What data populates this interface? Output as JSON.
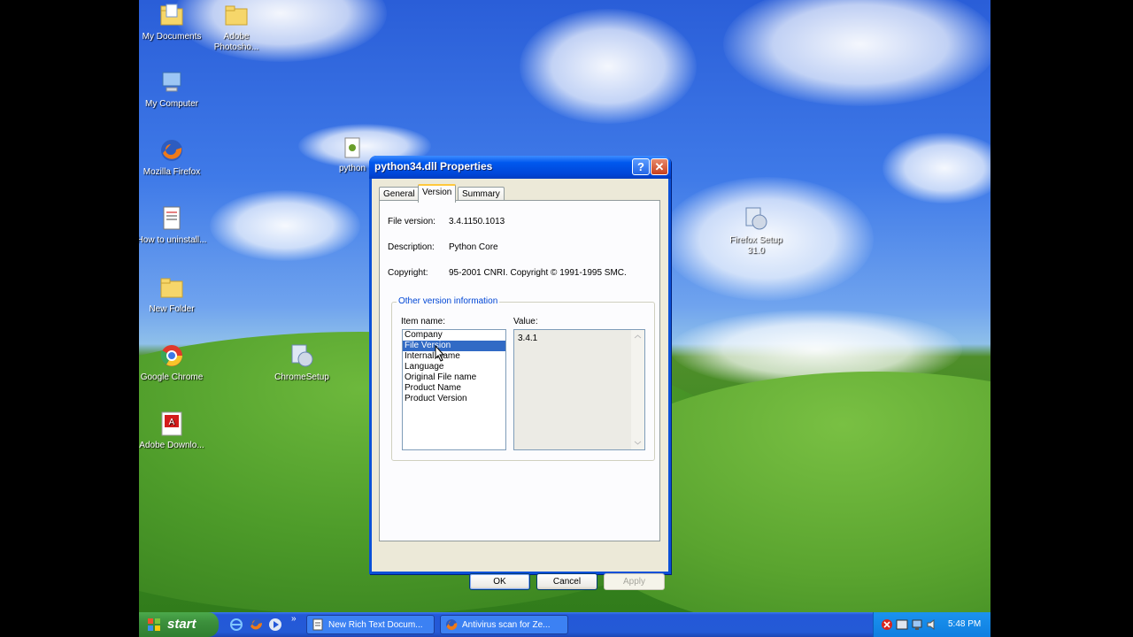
{
  "desktop": {
    "icons": [
      {
        "label": "My Documents"
      },
      {
        "label": "Adobe Photosho..."
      },
      {
        "label": "My Computer"
      },
      {
        "label": "Mozilla Firefox"
      },
      {
        "label": "How to uninstall..."
      },
      {
        "label": "New Folder"
      },
      {
        "label": "Google Chrome"
      },
      {
        "label": "ChromeSetup"
      },
      {
        "label": "Adobe Downlo..."
      },
      {
        "label": "Firefox Setup 31.0"
      },
      {
        "label": "python"
      }
    ]
  },
  "dialog": {
    "title": "python34.dll Properties",
    "help_label": "?",
    "close_label": "✕",
    "tabs": [
      {
        "label": "General"
      },
      {
        "label": "Version"
      },
      {
        "label": "Summary"
      }
    ],
    "file_version_label": "File version:",
    "file_version_value": "3.4.1150.1013",
    "description_label": "Description:",
    "description_value": "Python Core",
    "copyright_label": "Copyright:",
    "copyright_value": "95-2001 CNRI. Copyright © 1991-1995 SMC.",
    "group_title": "Other version information",
    "item_name_label": "Item name:",
    "value_label": "Value:",
    "items": [
      {
        "label": "Company"
      },
      {
        "label": "File Version"
      },
      {
        "label": "Internal Name"
      },
      {
        "label": "Language"
      },
      {
        "label": "Original File name"
      },
      {
        "label": "Product Name"
      },
      {
        "label": "Product Version"
      }
    ],
    "selected_value": "3.4.1",
    "ok_label": "OK",
    "cancel_label": "Cancel",
    "apply_label": "Apply"
  },
  "taskbar": {
    "start_label": "start",
    "items": [
      {
        "label": "New Rich Text Docum..."
      },
      {
        "label": "Antivirus scan for Ze..."
      }
    ],
    "clock": "5:48 PM"
  }
}
